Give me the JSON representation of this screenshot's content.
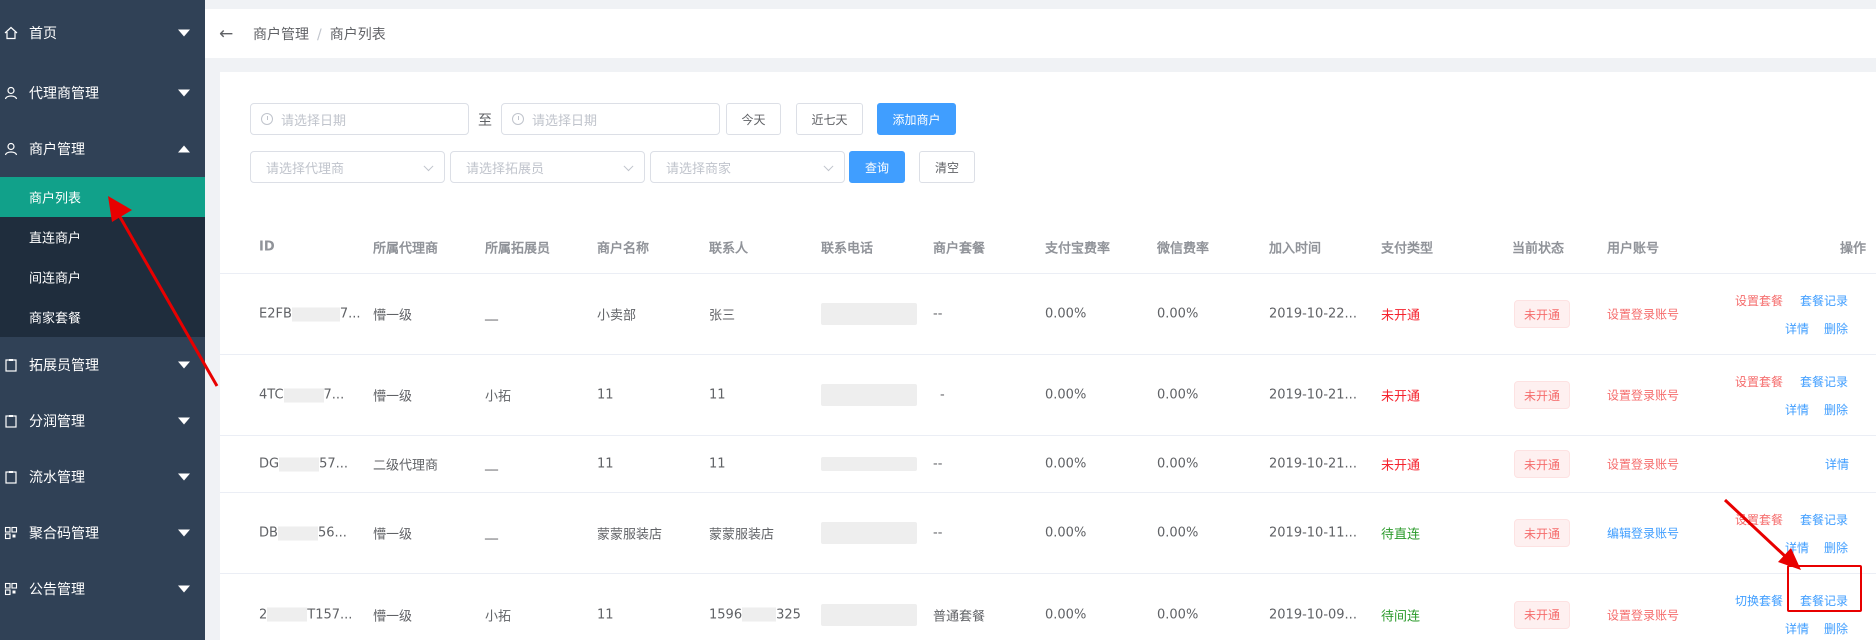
{
  "sidebar": {
    "items": [
      {
        "label": "首页",
        "icon": "home-icon"
      },
      {
        "label": "代理商管理",
        "icon": "user-icon"
      },
      {
        "label": "商户管理",
        "icon": "user-icon",
        "expanded": true
      },
      {
        "label": "拓展员管理",
        "icon": "clipboard-icon"
      },
      {
        "label": "分润管理",
        "icon": "clipboard-icon"
      },
      {
        "label": "流水管理",
        "icon": "clipboard-icon"
      },
      {
        "label": "聚合码管理",
        "icon": "qrcode-icon"
      },
      {
        "label": "公告管理",
        "icon": "qrcode-icon"
      }
    ],
    "submenu": [
      "商户列表",
      "直连商户",
      "间连商户",
      "商家套餐"
    ],
    "active_submenu": "商户列表"
  },
  "header": {
    "breadcrumb": [
      "商户管理",
      "商户列表"
    ]
  },
  "filters": {
    "date_start_placeholder": "请选择日期",
    "to_label": "至",
    "date_end_placeholder": "请选择日期",
    "today_button": "今天",
    "last7_button": "近七天",
    "add_button": "添加商户",
    "agent_placeholder": "请选择代理商",
    "promoter_placeholder": "请选择拓展员",
    "merchant_placeholder": "请选择商家",
    "query_button": "查询",
    "clear_button": "清空"
  },
  "table": {
    "headers": [
      "ID",
      "所属代理商",
      "所属拓展员",
      "商户名称",
      "联系人",
      "联系电话",
      "商户套餐",
      "支付宝费率",
      "微信费率",
      "加入时间",
      "支付类型",
      "当前状态",
      "用户账号",
      "操作"
    ],
    "rows": [
      {
        "id_prefix": "E2FB",
        "id_suffix": "7...",
        "agent": "懵一级",
        "promoter": "__",
        "name": "小卖部",
        "contact": "张三",
        "phone": "",
        "plan": "--",
        "alipay": "0.00%",
        "wechat": "0.00%",
        "joined": "2019-10-22...",
        "pay_type": "未开通",
        "pay_color": "red",
        "status": "未开通",
        "account": "设置登录账号",
        "account_color": "pink",
        "actions": [
          "设置套餐",
          "套餐记录",
          "详情",
          "删除"
        ]
      },
      {
        "id_prefix": "4TC",
        "id_suffix": "7...",
        "agent": "懵一级",
        "promoter": "小拓",
        "name": "11",
        "contact": "11",
        "phone": "",
        "plan": "-",
        "alipay": "0.00%",
        "wechat": "0.00%",
        "joined": "2019-10-21...",
        "pay_type": "未开通",
        "pay_color": "red",
        "status": "未开通",
        "account": "设置登录账号",
        "account_color": "pink",
        "actions": [
          "设置套餐",
          "套餐记录",
          "详情",
          "删除"
        ]
      },
      {
        "id_prefix": "DG",
        "id_suffix": "57...",
        "agent": "二级代理商",
        "promoter": "__",
        "name": "11",
        "contact": "11",
        "phone": "",
        "plan": "--",
        "alipay": "0.00%",
        "wechat": "0.00%",
        "joined": "2019-10-21...",
        "pay_type": "未开通",
        "pay_color": "red",
        "status": "未开通",
        "account": "设置登录账号",
        "account_color": "pink",
        "actions": [
          "详情"
        ]
      },
      {
        "id_prefix": "DB",
        "id_suffix": "56...",
        "agent": "懵一级",
        "promoter": "__",
        "name": "蒙蒙服装店",
        "contact": "蒙蒙服装店",
        "phone": "",
        "plan": "--",
        "alipay": "0.00%",
        "wechat": "0.00%",
        "joined": "2019-10-11...",
        "pay_type": "待直连",
        "pay_color": "green",
        "status": "未开通",
        "account": "编辑登录账号",
        "account_color": "blue",
        "actions": [
          "设置套餐",
          "套餐记录",
          "详情",
          "删除"
        ]
      },
      {
        "id_prefix": "2",
        "id_suffix": "T157...",
        "agent": "懵一级",
        "promoter": "小拓",
        "name": "11",
        "contact_prefix": "1596",
        "contact_suffix": "325",
        "phone": "",
        "plan": "普通套餐",
        "alipay": "0.00%",
        "wechat": "0.00%",
        "joined": "2019-10-09...",
        "pay_type": "待间连",
        "pay_color": "green",
        "status": "未开通",
        "account": "设置登录账号",
        "account_color": "pink",
        "actions": [
          "切换套餐",
          "套餐记录",
          "详情",
          "删除"
        ]
      }
    ]
  },
  "colors": {
    "sidebar_bg": "#304156",
    "submenu_bg": "#1f2d3d",
    "active_bg": "#11a18a",
    "primary": "#409eff",
    "danger": "#f56c6c",
    "annotation": "#e80000"
  }
}
